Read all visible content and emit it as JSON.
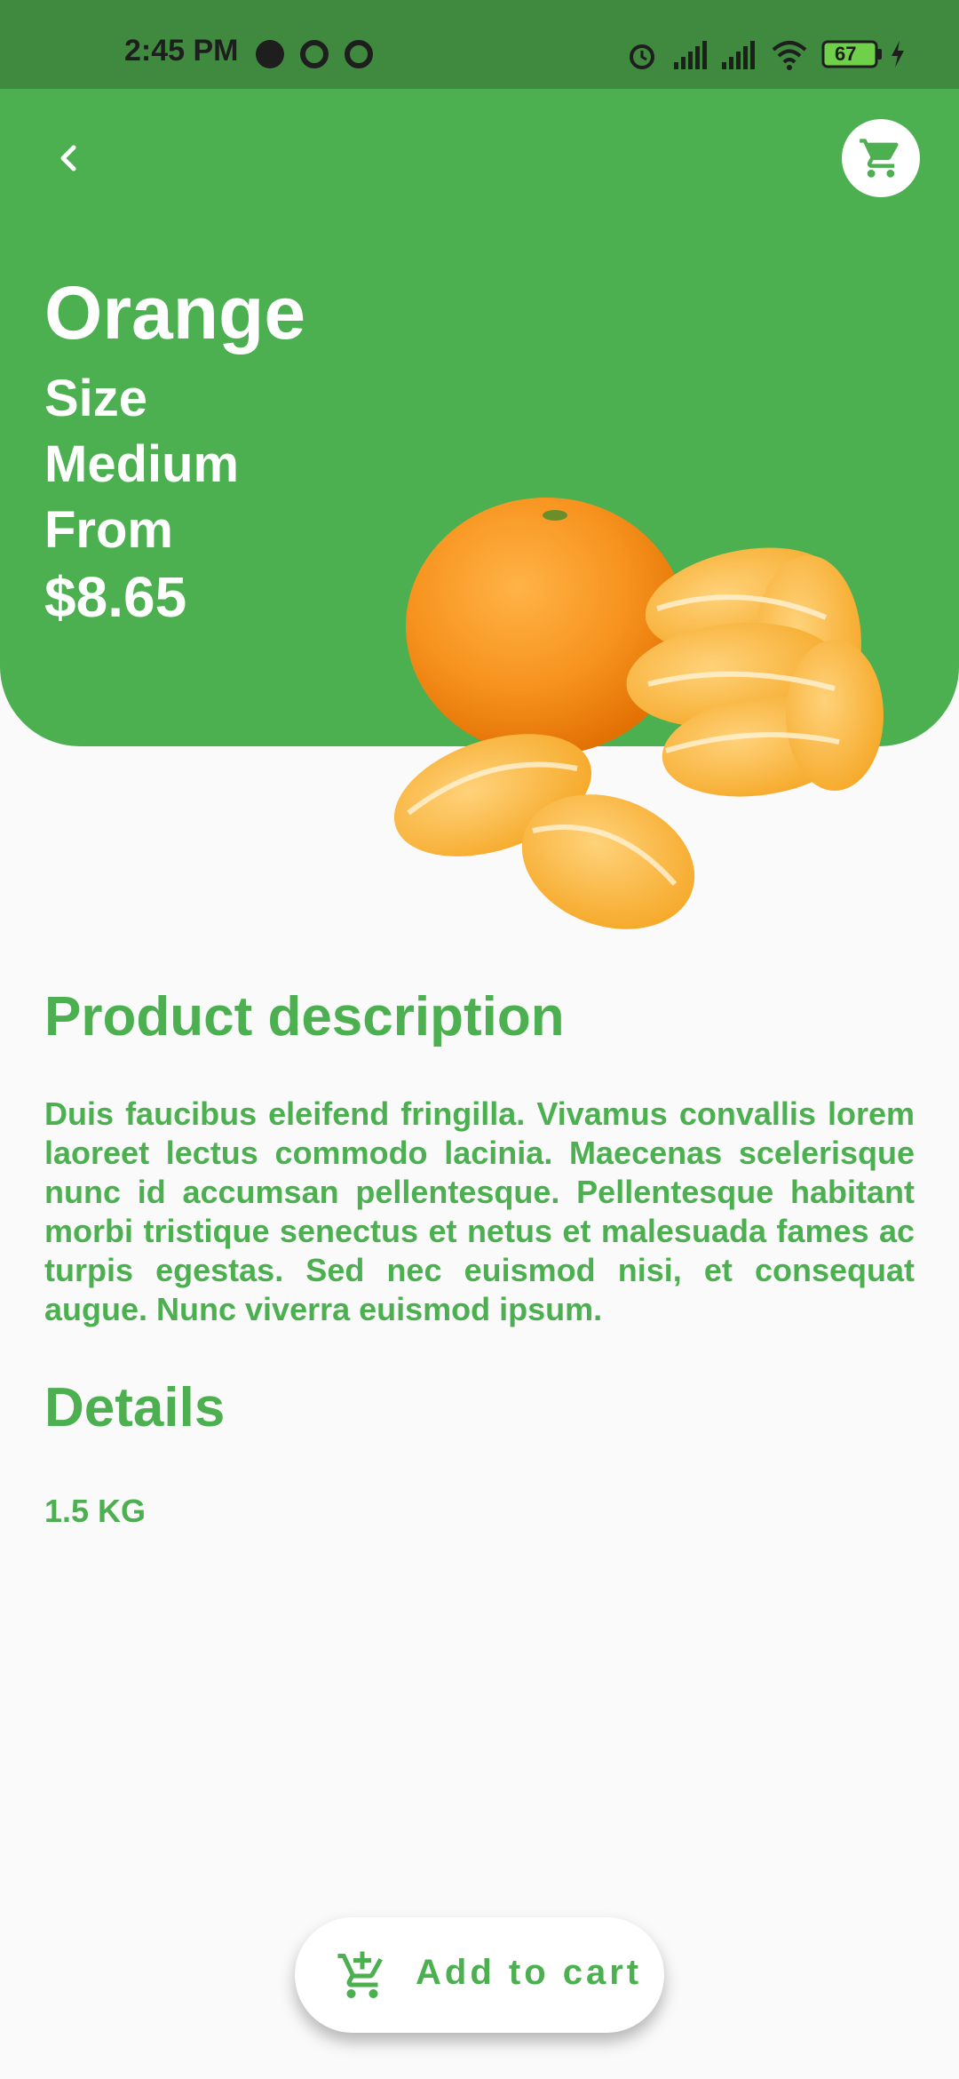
{
  "status_bar": {
    "time": "2:45 PM",
    "battery_level": "67",
    "icons": [
      "messenger-icon",
      "app-icon",
      "app-icon",
      "alarm-icon",
      "signal-icon",
      "signal-icon",
      "wifi-icon",
      "battery-icon",
      "charging-icon"
    ]
  },
  "header": {
    "back_icon": "chevron-left-icon",
    "cart_icon": "shopping-cart-icon",
    "background_color": "#4caf50"
  },
  "product": {
    "name": "Orange",
    "size_label": "Size",
    "size_value": "Medium",
    "price_label": "From",
    "price": "$8.65",
    "image": "orange-image"
  },
  "description": {
    "heading": "Product description",
    "text": "Duis faucibus eleifend fringilla. Vivamus convallis lorem laoreet lectus commodo lacinia. Maecenas scelerisque nunc id accumsan pellentesque. Pellentesque habitant morbi tristique senectus et netus et malesuada fames ac turpis egestas. Sed nec euismod nisi, et consequat augue. Nunc viverra euismod ipsum."
  },
  "details": {
    "heading": "Details",
    "value": "1.5 KG"
  },
  "actions": {
    "add_to_cart_label": "Add to cart",
    "add_to_cart_icon": "add-shopping-cart-icon"
  },
  "colors": {
    "accent": "#4caf50",
    "status_bar": "#3f8a3f",
    "background": "#fafafa"
  }
}
